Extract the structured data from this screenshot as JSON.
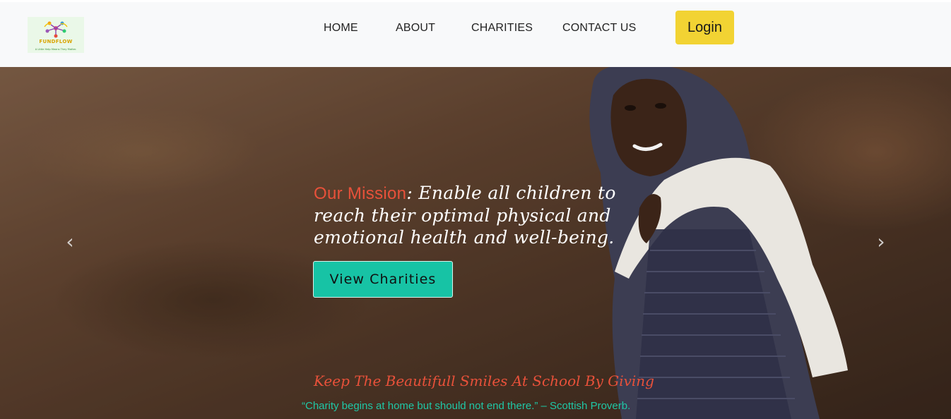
{
  "brand": {
    "name": "FUNDFLOW",
    "tagline": "A Little Help Means They Matter."
  },
  "nav": {
    "items": [
      {
        "label": "HOME"
      },
      {
        "label": "ABOUT"
      },
      {
        "label": "CHARITIES"
      },
      {
        "label": "CONTACT US"
      }
    ],
    "login_label": "Login"
  },
  "hero": {
    "mission_label": "Our Mission",
    "mission_text": ": Enable all children to reach their optimal physical and emotional health and well-being.",
    "cta_label": "View Charities",
    "tagline": "Keep The Beautifull Smiles At School By Giving",
    "quote": "“Charity begins at home but should not end there.” – Scottish Proverb.",
    "prev_icon": "chevron-left-icon",
    "next_icon": "chevron-right-icon"
  },
  "colors": {
    "navbar_bg": "#f8f9fa",
    "login_bg": "#f2d333",
    "cta_bg": "#17c3a5",
    "accent_red": "#e8513a",
    "accent_teal": "#1fc7a6"
  }
}
